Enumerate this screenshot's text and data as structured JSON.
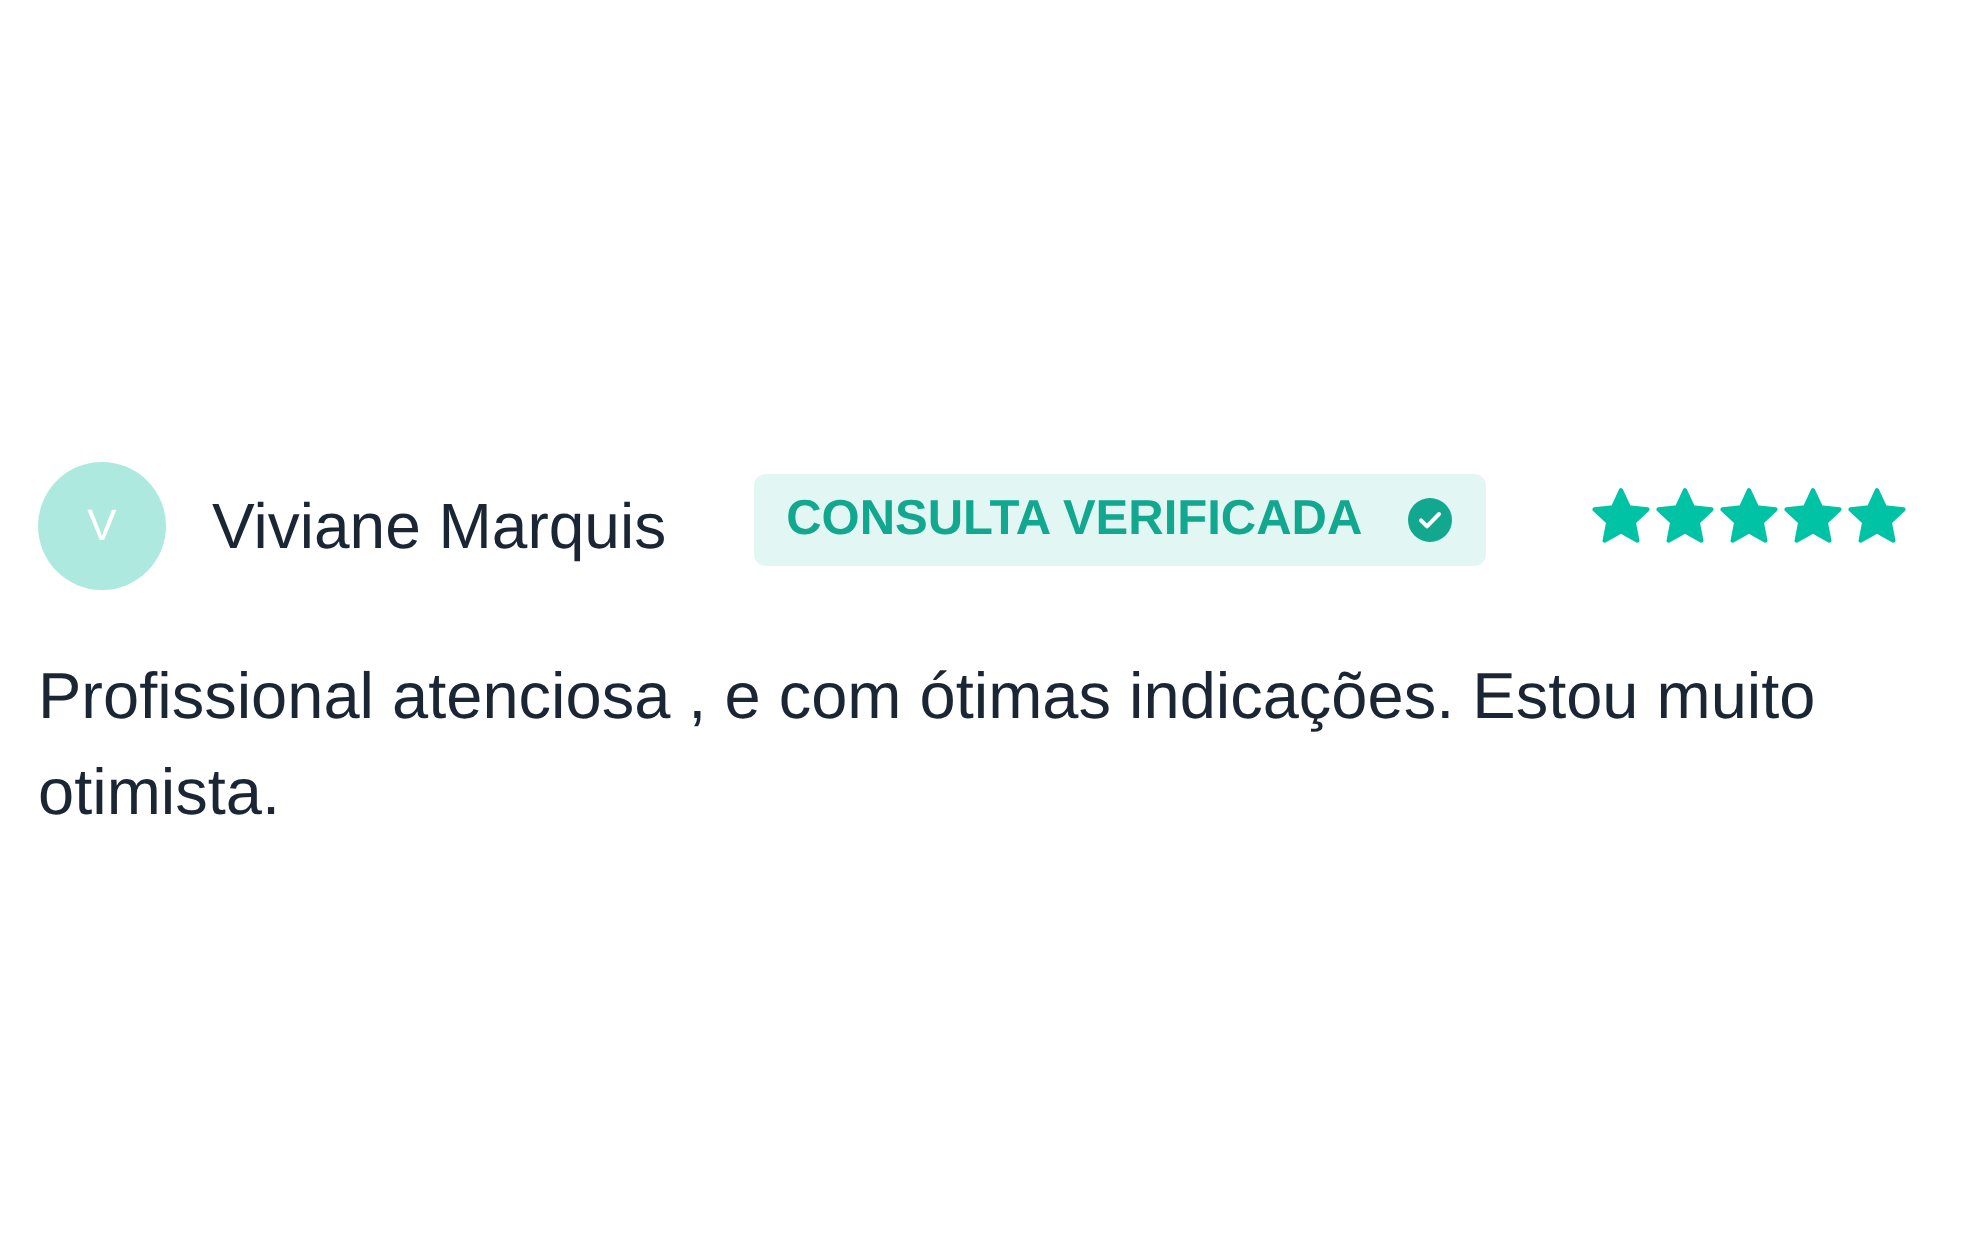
{
  "review": {
    "author": {
      "initial": "V",
      "name": "Viviane Marquis"
    },
    "badge": {
      "label": "CONSULTA VERIFICADA"
    },
    "rating": {
      "stars": 5
    },
    "text": "Profissional atenciosa , e com ótimas indicações. Estou muito otimista."
  }
}
